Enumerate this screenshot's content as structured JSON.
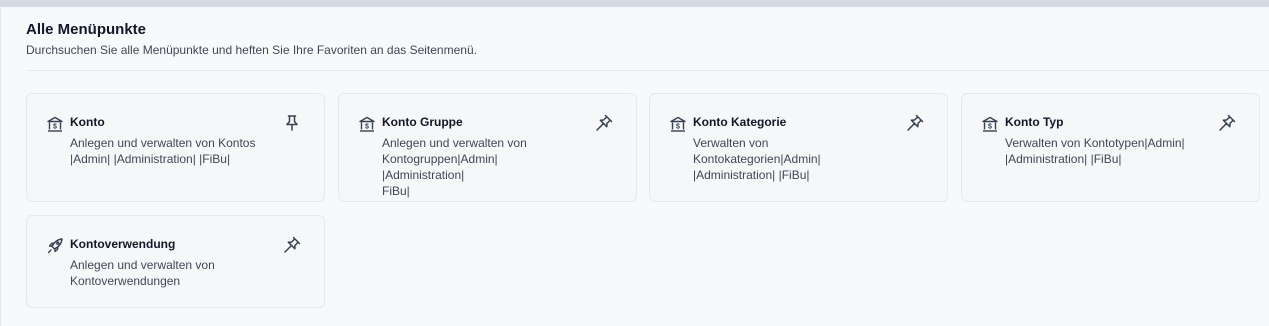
{
  "page": {
    "title": "Alle Menüpunkte",
    "subtitle": "Durchsuchen Sie alle Menüpunkte und heften Sie Ihre Favoriten an das Seitenmenü."
  },
  "cards": [
    {
      "name": "Konto",
      "description": "Anlegen und verwalten von Kontos\n|Admin| |Administration| |FiBu|",
      "icon": "bank-icon",
      "pinned": true
    },
    {
      "name": "Konto Gruppe",
      "description": "Anlegen und verwalten von\nKontogruppen|Admin| |Administration|\nFiBu|",
      "icon": "bank-icon",
      "pinned": false
    },
    {
      "name": "Konto Kategorie",
      "description": "Verwalten von Kontokategorien|Admin|\n|Administration| |FiBu|",
      "icon": "bank-icon",
      "pinned": false
    },
    {
      "name": "Konto Typ",
      "description": "Verwalten von Kontotypen|Admin|\n|Administration| |FiBu|",
      "icon": "bank-icon",
      "pinned": false
    },
    {
      "name": "Kontoverwendung",
      "description": "Anlegen und verwalten von\nKontoverwendungen",
      "icon": "rocket-icon",
      "pinned": false
    }
  ]
}
